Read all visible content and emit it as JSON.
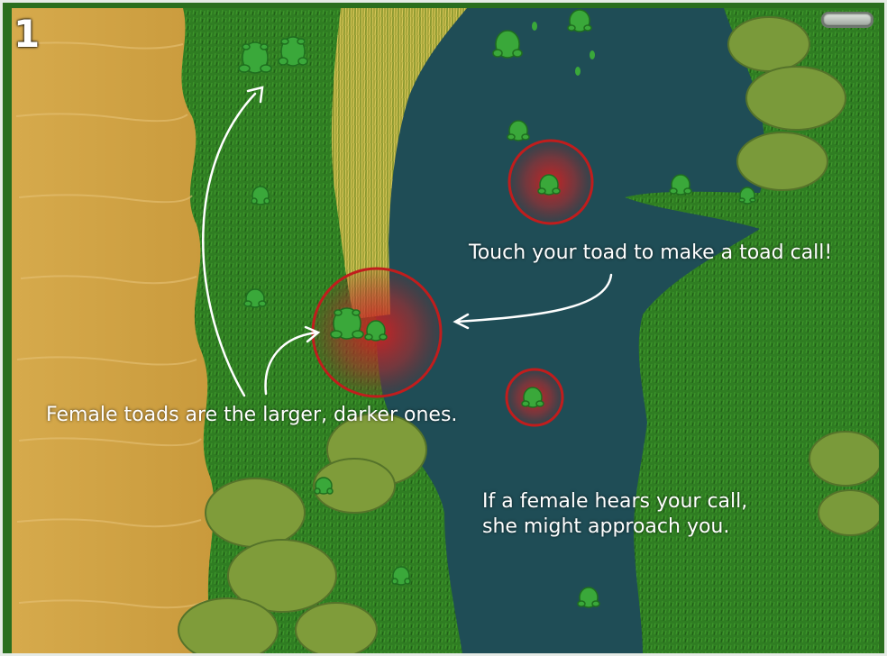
{
  "level": {
    "number": "1"
  },
  "hints": {
    "touch_call": "Touch your toad to make a toad call!",
    "female_larger": "Female toads are the larger, darker ones.",
    "female_approach": "If a female hears your call,\nshe might approach you."
  },
  "icons": {
    "menu": "menu-button-icon",
    "toad": "toad-icon",
    "call_ring": "call-ring-icon"
  },
  "colors": {
    "water": "#1f4d56",
    "grass": "#2f7d22",
    "sand": "#d4a84a",
    "ring": "#c01d1d",
    "toad": "#3aa83a"
  }
}
